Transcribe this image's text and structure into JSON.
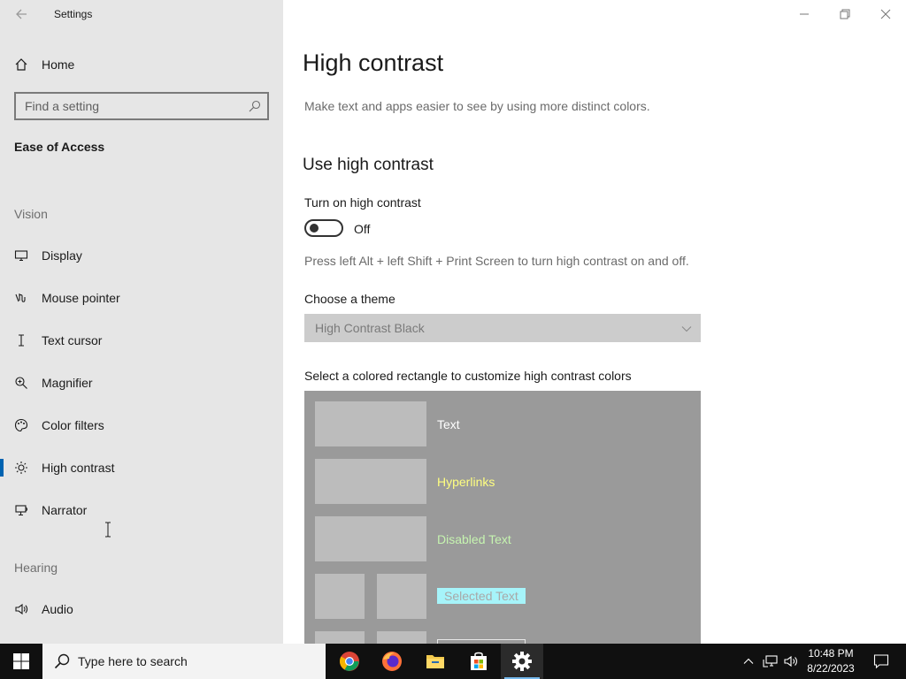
{
  "window": {
    "title": "Settings"
  },
  "sidebar": {
    "home_label": "Home",
    "search_placeholder": "Find a setting",
    "category": "Ease of Access",
    "section_vision": "Vision",
    "section_hearing": "Hearing",
    "items": [
      {
        "label": "Display",
        "icon": "display-icon"
      },
      {
        "label": "Mouse pointer",
        "icon": "mouse-pointer-icon"
      },
      {
        "label": "Text cursor",
        "icon": "text-cursor-icon"
      },
      {
        "label": "Magnifier",
        "icon": "magnifier-icon"
      },
      {
        "label": "Color filters",
        "icon": "color-filters-icon"
      },
      {
        "label": "High contrast",
        "icon": "high-contrast-icon",
        "selected": true
      },
      {
        "label": "Narrator",
        "icon": "narrator-icon"
      },
      {
        "label": "Audio",
        "icon": "audio-icon"
      }
    ]
  },
  "main": {
    "title": "High contrast",
    "description": "Make text and apps easier to see by using more distinct colors.",
    "section_title": "Use high contrast",
    "toggle_label": "Turn on high contrast",
    "toggle_state": "Off",
    "shortcut_hint": "Press left Alt + left Shift + Print Screen to turn high contrast on and off.",
    "theme_label": "Choose a theme",
    "theme_value": "High Contrast Black",
    "customize_label": "Select a colored rectangle to customize high contrast colors",
    "swatches": [
      {
        "label": "Text",
        "color": "#ffffff"
      },
      {
        "label": "Hyperlinks",
        "color": "#ffff80"
      },
      {
        "label": "Disabled Text",
        "color": "#c6f4b0"
      },
      {
        "label": "Selected Text",
        "color": "#a8a8a8",
        "highlight": "#a6f4fa"
      }
    ]
  },
  "taskbar": {
    "search_placeholder": "Type here to search",
    "apps": [
      "chrome-icon",
      "firefox-icon",
      "file-explorer-icon",
      "store-icon",
      "settings-icon"
    ],
    "time": "10:48 PM",
    "date": "8/22/2023"
  },
  "colors": {
    "accent": "#0063b1",
    "sidebar_bg": "#e6e6e6",
    "taskbar_bg": "#101010"
  }
}
